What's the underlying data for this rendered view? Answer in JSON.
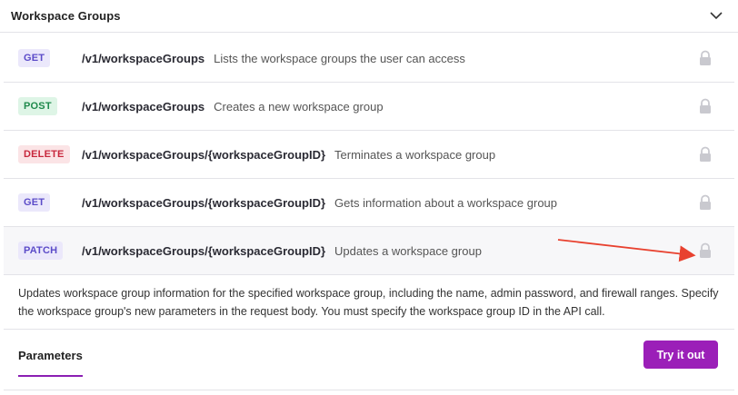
{
  "section": {
    "title": "Workspace Groups",
    "chevron_icon": "chevron-down-icon"
  },
  "operations": [
    {
      "method": "GET",
      "path": "/v1/workspaceGroups",
      "description": "Lists the workspace groups the user can access",
      "lock_icon": "lock-icon"
    },
    {
      "method": "POST",
      "path": "/v1/workspaceGroups",
      "description": "Creates a new workspace group",
      "lock_icon": "lock-icon"
    },
    {
      "method": "DELETE",
      "path": "/v1/workspaceGroups/{workspaceGroupID}",
      "description": "Terminates a workspace group",
      "lock_icon": "lock-icon"
    },
    {
      "method": "GET",
      "path": "/v1/workspaceGroups/{workspaceGroupID}",
      "description": "Gets information about a workspace group",
      "lock_icon": "lock-icon"
    },
    {
      "method": "PATCH",
      "path": "/v1/workspaceGroups/{workspaceGroupID}",
      "description": "Updates a workspace group",
      "lock_icon": "lock-icon"
    }
  ],
  "details": {
    "text": "Updates workspace group information for the specified workspace group, including the name, admin password, and firewall ranges. Specify the workspace group's new parameters in the request body. You must specify the workspace group ID in the API call."
  },
  "parameters": {
    "tab_label": "Parameters",
    "try_button_label": "Try it out"
  },
  "colors": {
    "accent": "#9b1fb8",
    "annotation_arrow": "#e8412f"
  }
}
